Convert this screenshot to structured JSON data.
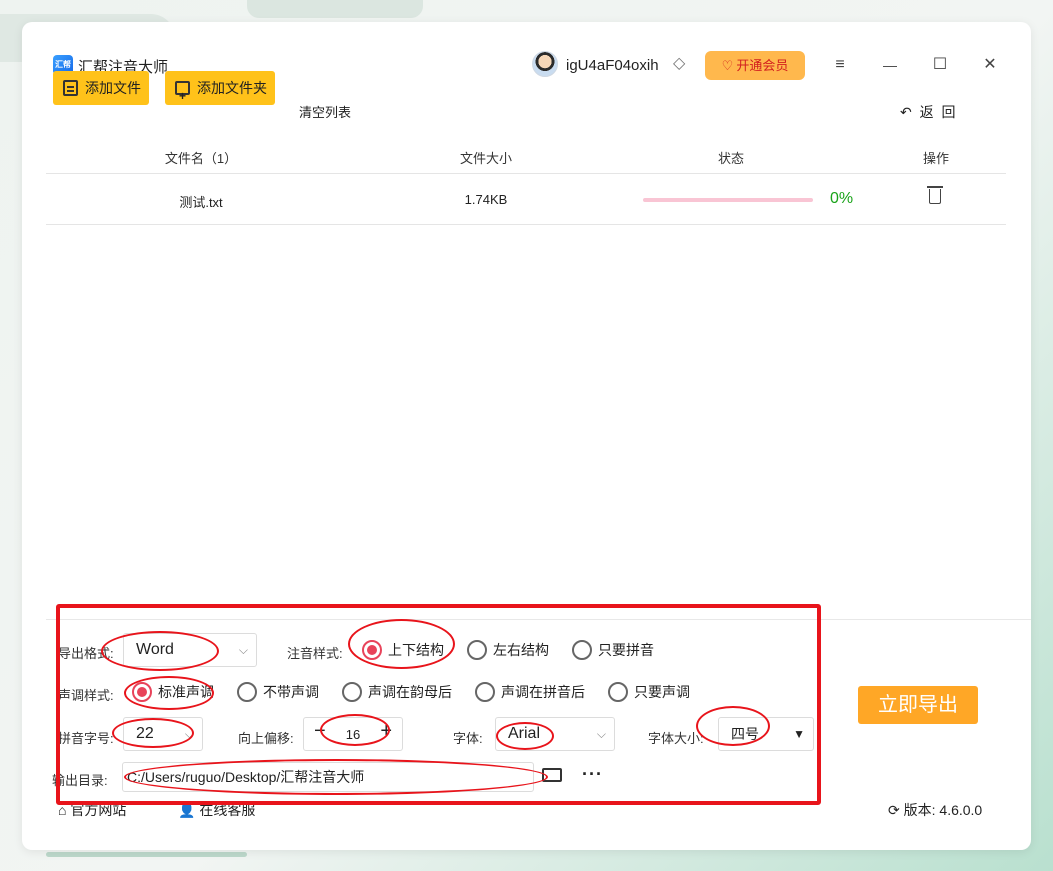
{
  "app": {
    "title": "汇帮注音大师",
    "logo_text": "汇帮"
  },
  "user": {
    "name": "igU4aF04oxih"
  },
  "vip_button": {
    "label": "开通会员"
  },
  "window_controls": {
    "menu": "≡",
    "minimize": "—",
    "maximize": "☐",
    "close": "✕"
  },
  "toolbar": {
    "add_file": "添加文件",
    "add_folder": "添加文件夹",
    "clear_list": "清空列表",
    "back": "返 回",
    "back_icon": "↶"
  },
  "table": {
    "headers": {
      "filename": "文件名（1）",
      "filesize": "文件大小",
      "status": "状态",
      "action": "操作"
    },
    "rows": [
      {
        "filename": "测试.txt",
        "filesize": "1.74KB",
        "progress": "0%",
        "progress_value": 0
      }
    ]
  },
  "settings": {
    "export_format": {
      "label": "导出格式:",
      "value": "Word"
    },
    "annotation_style": {
      "label": "注音样式:",
      "options": [
        "上下结构",
        "左右结构",
        "只要拼音"
      ],
      "selected": 0
    },
    "tone_style": {
      "label": "声调样式:",
      "options": [
        "标准声调",
        "不带声调",
        "声调在韵母后",
        "声调在拼音后",
        "只要声调"
      ],
      "selected": 0
    },
    "pinyin_size": {
      "label": "拼音字号:",
      "value": "22"
    },
    "offset": {
      "label": "向上偏移:",
      "value": "16",
      "minus": "−",
      "plus": "+"
    },
    "font": {
      "label": "字体:",
      "value": "Arial"
    },
    "font_size": {
      "label": "字体大小:",
      "value": "四号"
    },
    "output_dir": {
      "label": "输出目录:",
      "value": "C:/Users/ruguo/Desktop/汇帮注音大师",
      "more": "···"
    },
    "export_button": "立即导出"
  },
  "footer": {
    "website": "官方网站",
    "support": "在线客服",
    "version_label": "版本:",
    "version": "4.6.0.0"
  },
  "colors": {
    "accent_yellow": "#ffc21a",
    "export_orange": "#ffa726",
    "radio_selected": "#e8435a",
    "annotation_red": "#e8141b",
    "progress_text": "#1aa31a"
  }
}
